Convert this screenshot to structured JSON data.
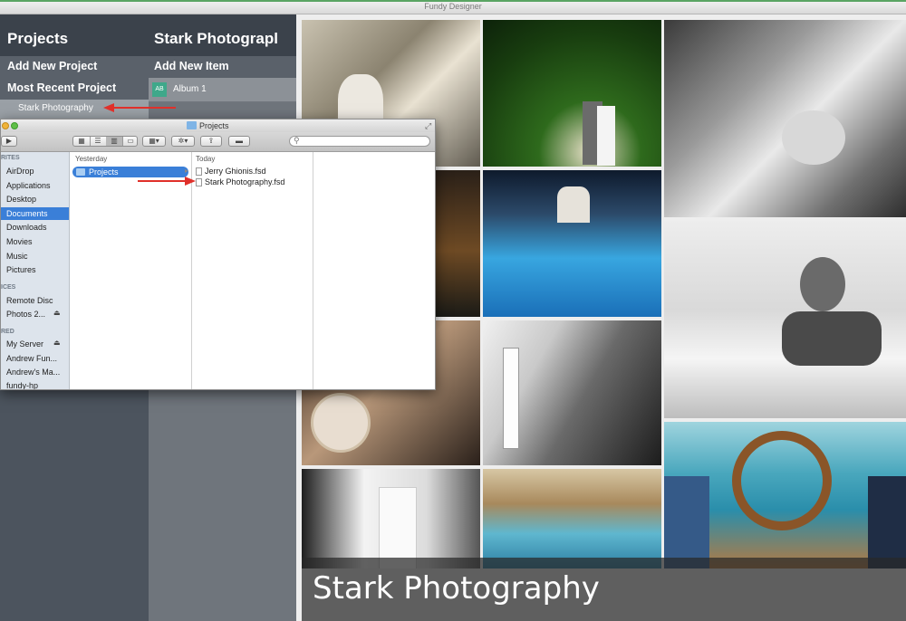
{
  "window": {
    "title": "Fundy Designer"
  },
  "projects_panel": {
    "heading": "Projects",
    "add_new_project": "Add New Project",
    "most_recent_project": "Most Recent Project",
    "recent_item": "Stark Photography"
  },
  "project_panel": {
    "heading": "Stark Photograpl",
    "add_new_item": "Add New Item",
    "album_badge": "AB",
    "album_label": "Album 1"
  },
  "finder": {
    "title": "Projects",
    "sidebar": {
      "favorites_header": "RITES",
      "favorites": [
        "AirDrop",
        "Applications",
        "Desktop",
        "Documents",
        "Downloads",
        "Movies",
        "Music",
        "Pictures"
      ],
      "selected": "Documents",
      "devices_header": "ICES",
      "devices": [
        "Remote Disc",
        "Photos 2..."
      ],
      "shared_header": "RED",
      "shared": [
        "My Server",
        "Andrew Fun...",
        "Andrew's Ma...",
        "fundy-hp"
      ]
    },
    "column1": {
      "header": "Yesterday",
      "items": [
        "Projects"
      ]
    },
    "column2": {
      "header": "Today",
      "items": [
        "Jerry Ghionis.fsd",
        "Stark Photography.fsd"
      ]
    }
  },
  "gallery": {
    "banner_title": "Stark Photography"
  },
  "colors": {
    "annotation_arrow": "#e0302a",
    "finder_selection": "#3a7fd8",
    "app_dark": "#3b424b"
  }
}
